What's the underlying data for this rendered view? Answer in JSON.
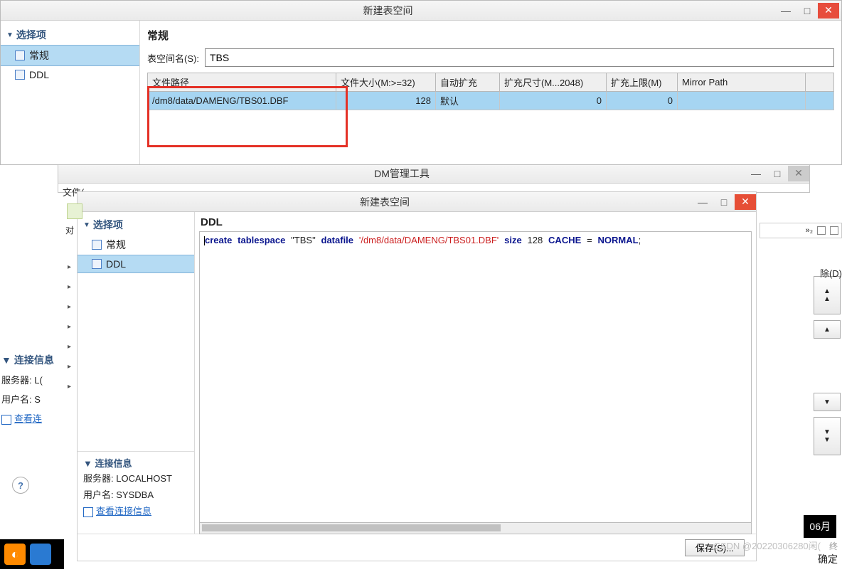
{
  "dialog1": {
    "title": "新建表空间",
    "minimize": "—",
    "maximize": "□",
    "close": "✕",
    "sidebar_header": "选择项",
    "items": [
      {
        "label": "常规",
        "selected": true
      },
      {
        "label": "DDL",
        "selected": false
      }
    ],
    "section_label": "常规",
    "name_label": "表空间名(S):",
    "name_value": "TBS",
    "columns": {
      "path": "文件路径",
      "size": "文件大小(M:>=32)",
      "auto": "自动扩充",
      "step": "扩充尺寸(M...2048)",
      "limit": "扩充上限(M)",
      "mirror": "Mirror Path"
    },
    "row": {
      "path": "/dm8/data/DAMENG/TBS01.DBF",
      "size": "128",
      "auto": "默认",
      "step": "0",
      "limit": "0",
      "mirror": ""
    }
  },
  "mainwin": {
    "title": "DM管理工具",
    "menu_file": "文件(",
    "menu_close": "✕"
  },
  "dialog2": {
    "title": "新建表空间",
    "minimize": "—",
    "maximize": "□",
    "close": "✕",
    "sidebar_header": "选择项",
    "items": [
      {
        "label": "常规",
        "selected": false
      },
      {
        "label": "DDL",
        "selected": true
      }
    ],
    "section_label": "DDL",
    "ddl": {
      "kw1": "create",
      "kw2": "tablespace",
      "q1": "\"TBS\"",
      "kw3": "datafile",
      "str1": "'/dm8/data/DAMENG/TBS01.DBF'",
      "kw4": "size",
      "num1": "128",
      "kw5": "CACHE",
      "eq": "=",
      "kw6": "NORMAL",
      "semi": ";"
    },
    "save_btn": "保存(S)...",
    "conn_header": "连接信息",
    "server_label": "服务器:",
    "server_value": "LOCALHOST",
    "user_label": "用户名:",
    "user_value": "SYSDBA",
    "view_link": "查看连接信息"
  },
  "bg": {
    "conn_header": "连接信息",
    "server_label": "服务器:",
    "server_value": "L(",
    "user_label": "用户名:",
    "user_value": "S",
    "view_link": "查看连",
    "help": "?",
    "dui": "对",
    "sub2": "»₂"
  },
  "rightedge": {
    "delete": "除(D)",
    "up": "▲",
    "down": "▼"
  },
  "footer": {
    "ok": "确定",
    "date": "06月",
    "watermark": "CSDN @20220306280闲(",
    "wm2": "终"
  }
}
